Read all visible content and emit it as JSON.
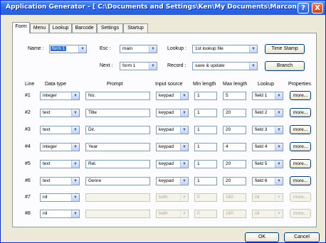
{
  "window": {
    "title": "Application Generator - [ C:\\Documents and Settings\\Ken\\My Documents\\Marcom\\Video Media ...",
    "help_glyph": "?",
    "close_glyph": "X"
  },
  "tabs": [
    "Form",
    "Menu",
    "Lookup",
    "Barcode",
    "Settings",
    "Startup"
  ],
  "header": {
    "name_label": "Name :",
    "name_value": "form 1",
    "esc_label": "Esc :",
    "esc_value": "main",
    "lookup_label": "Lookup :",
    "lookup_value": "1st lookup file",
    "timestamp_button": "Time Stamp",
    "next_label": "Next :",
    "next_value": "form 1",
    "record_label": "Record :",
    "record_value": "save & update",
    "branch_button": "Branch"
  },
  "columns": {
    "line": "Line",
    "data_type": "Data type",
    "prompt": "Prompt",
    "input_source": "Input source",
    "min_length": "Min length",
    "max_length": "Max length",
    "lookup": "Lookup",
    "properties": "Properties"
  },
  "rows": [
    {
      "line": "#1",
      "data_type": "integer",
      "prompt": "No.",
      "input_source": "keypad",
      "min": "1",
      "max": "5",
      "lookup": "field 1",
      "props": "more..."
    },
    {
      "line": "#2",
      "data_type": "text",
      "prompt": "Title",
      "input_source": "keypad",
      "min": "1",
      "max": "20",
      "lookup": "field 2",
      "props": "more..."
    },
    {
      "line": "#3",
      "data_type": "text",
      "prompt": "Dir.",
      "input_source": "keypad",
      "min": "1",
      "max": "20",
      "lookup": "field 3",
      "props": "more..."
    },
    {
      "line": "#4",
      "data_type": "integer",
      "prompt": "Year",
      "input_source": "keypad",
      "min": "1",
      "max": "4",
      "lookup": "field 4",
      "props": "more..."
    },
    {
      "line": "#5",
      "data_type": "text",
      "prompt": "Rel.",
      "input_source": "keypad",
      "min": "1",
      "max": "20",
      "lookup": "field 5",
      "props": "more..."
    },
    {
      "line": "#6",
      "data_type": "text",
      "prompt": "Genre",
      "input_source": "keypad",
      "min": "1",
      "max": "20",
      "lookup": "field 6",
      "props": "more..."
    },
    {
      "line": "#7",
      "data_type": "nil",
      "prompt": "",
      "input_source": "both",
      "min": "0",
      "max": "160",
      "lookup": "nil",
      "props": "more..."
    },
    {
      "line": "#8",
      "data_type": "nil",
      "prompt": "",
      "input_source": "both",
      "min": "0",
      "max": "160",
      "lookup": "nil",
      "props": "more..."
    }
  ],
  "footer": {
    "ok_button": "OK",
    "cancel_button": "Cancel"
  },
  "dropdown_arrow": "▼"
}
